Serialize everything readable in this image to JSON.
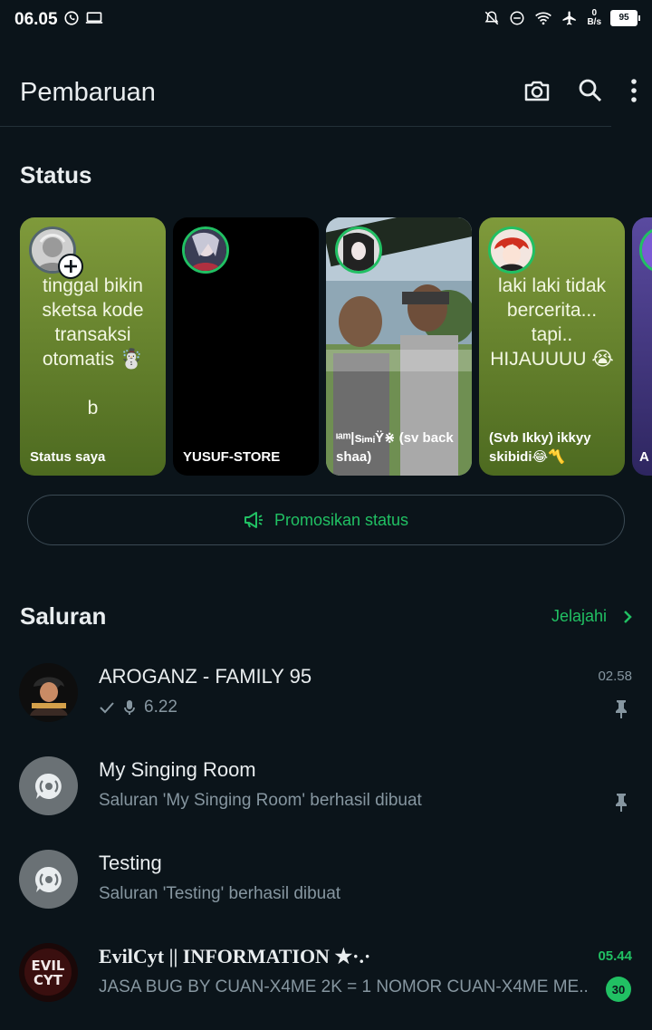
{
  "status_bar": {
    "time": "06.05",
    "net_speed_value": "0",
    "net_speed_unit": "B/s",
    "battery": "95"
  },
  "header": {
    "title": "Pembaruan",
    "icons": [
      "camera-icon",
      "search-icon",
      "more-options-icon"
    ]
  },
  "status_section": {
    "title": "Status",
    "cards": [
      {
        "name": "Status saya",
        "text": "tinggal bikin sketsa kode transaksi otomatis ☃️\n\nb",
        "bg": "#7f9a3b"
      },
      {
        "name": "YUSUF-STORE",
        "text": "",
        "bg": "#000000"
      },
      {
        "name": "ᶦᵃᵐ|sᵢₘᵢŸ⋇ (sv back shaa)",
        "text": "",
        "bg": "#6d8a5a"
      },
      {
        "name": "(Svb Ikky) ikkyy skibidi😂〽️",
        "text": "laki laki tidak bercerita... tapi.. HIJAUUUU 😭",
        "bg": "#7f9a3b"
      },
      {
        "name": "A W",
        "text": "",
        "bg": "#4a3f7a"
      }
    ],
    "promote_label": "Promosikan status"
  },
  "channels_section": {
    "title": "Saluran",
    "explore_label": "Jelajahi",
    "items": [
      {
        "name": "AROGANZ - FAMILY 95",
        "subtitle": "6.22",
        "time": "02.58",
        "pinned": true
      },
      {
        "name": "My Singing Room",
        "subtitle": "Saluran 'My Singing Room' berhasil dibuat",
        "time": "",
        "pinned": true
      },
      {
        "name": "Testing",
        "subtitle": "Saluran 'Testing' berhasil dibuat",
        "time": "",
        "pinned": false
      },
      {
        "name": "EvilCyt || INFORMATION ★·.·",
        "subtitle": "JASA BUG BY CUAN-X4ME 2K = 1 NOMOR  CUAN-X4ME ME...",
        "time": "05.44",
        "unread": "30"
      }
    ]
  },
  "colors": {
    "background": "#0b141a",
    "accent": "#21c063",
    "secondary_text": "#8696a0"
  }
}
